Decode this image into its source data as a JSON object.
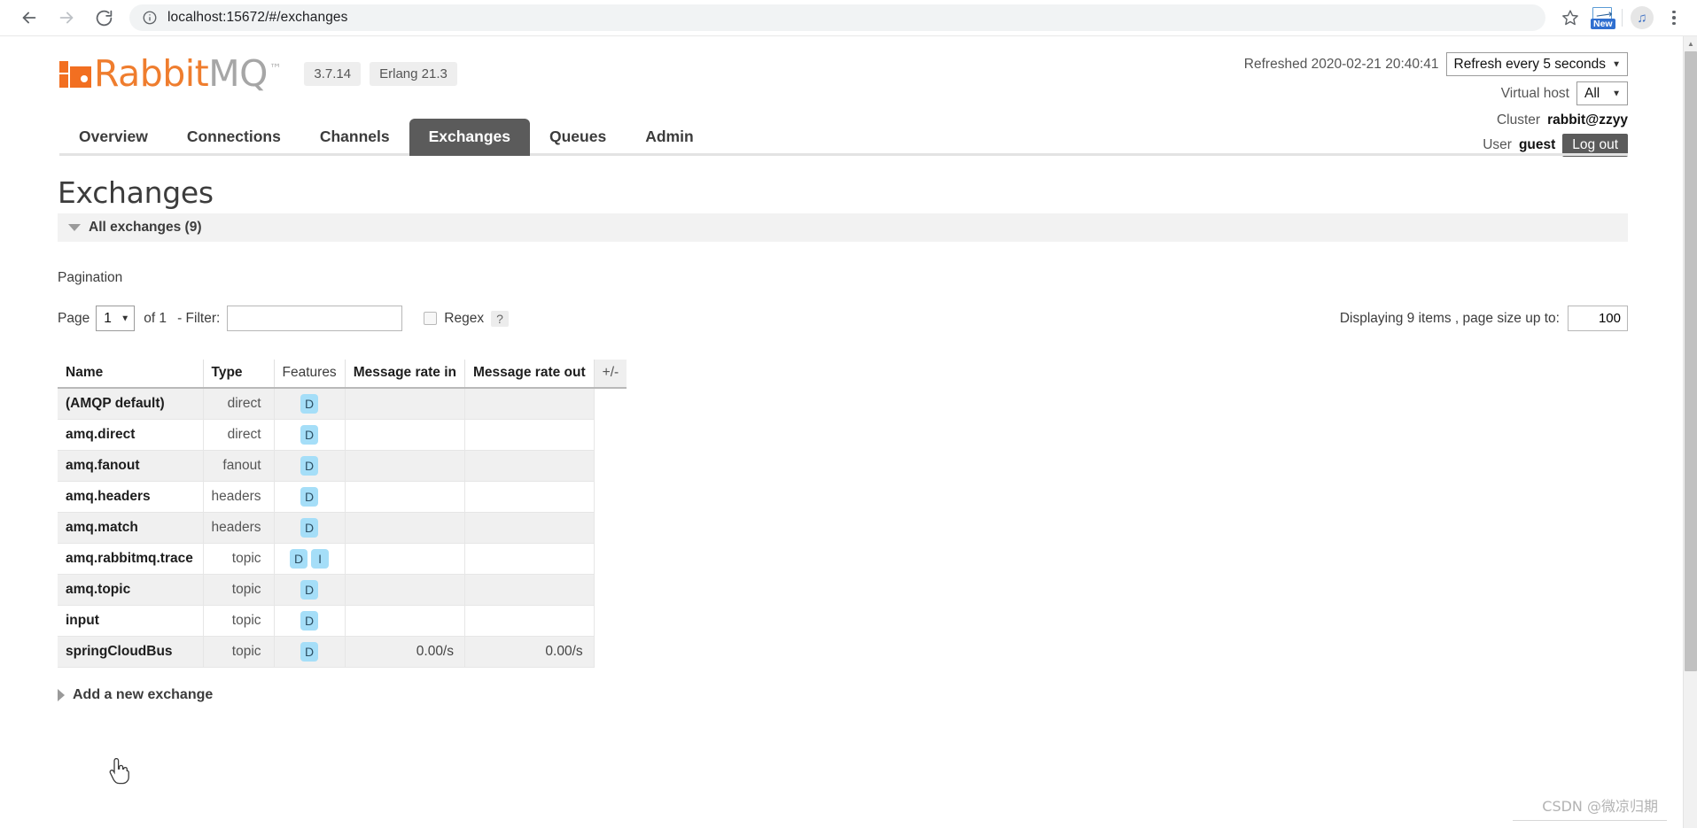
{
  "browser": {
    "back_icon": "arrow-left-icon",
    "forward_icon": "arrow-right-icon",
    "reload_icon": "reload-icon",
    "site_info_icon": "info-circle-icon",
    "url_scheme": "",
    "url": "localhost:15672/#/exchanges",
    "bookmark_icon": "star-icon",
    "extension_new_label": "New",
    "extension_music_icon": "music-note-icon",
    "menu_icon": "kebab-menu-icon"
  },
  "header": {
    "logo_primary": "Rabbit",
    "logo_secondary": "MQ",
    "logo_tm": "™",
    "version_badge": "3.7.14",
    "erlang_badge": "Erlang 21.3",
    "refreshed_text": "Refreshed 2020-02-21 20:40:41",
    "refresh_interval": "Refresh every 5 seconds",
    "virtual_host_label": "Virtual host",
    "virtual_host_value": "All",
    "cluster_label": "Cluster",
    "cluster_value": "rabbit@zzyy",
    "user_label": "User",
    "user_value": "guest",
    "logout_label": "Log out"
  },
  "nav": {
    "tabs": [
      {
        "label": "Overview",
        "active": false
      },
      {
        "label": "Connections",
        "active": false
      },
      {
        "label": "Channels",
        "active": false
      },
      {
        "label": "Exchanges",
        "active": true
      },
      {
        "label": "Queues",
        "active": false
      },
      {
        "label": "Admin",
        "active": false
      }
    ]
  },
  "main": {
    "page_title": "Exchanges",
    "section_label": "All exchanges (9)",
    "pagination_label": "Pagination",
    "page_label": "Page",
    "page_value": "1",
    "of_text": "of 1",
    "filter_label": "- Filter:",
    "filter_value": "",
    "filter_placeholder": "",
    "regex_label": "Regex",
    "help_label": "?",
    "displaying_text": "Displaying 9 items , page size up to:",
    "page_size_value": "100",
    "add_exchange_label": "Add a new exchange"
  },
  "table": {
    "columns": [
      "Name",
      "Type",
      "Features",
      "Message rate in",
      "Message rate out",
      "+/-"
    ],
    "rows": [
      {
        "name": "(AMQP default)",
        "type": "direct",
        "features": [
          "D"
        ],
        "rate_in": "",
        "rate_out": "",
        "link": false
      },
      {
        "name": "amq.direct",
        "type": "direct",
        "features": [
          "D"
        ],
        "rate_in": "",
        "rate_out": "",
        "link": false
      },
      {
        "name": "amq.fanout",
        "type": "fanout",
        "features": [
          "D"
        ],
        "rate_in": "",
        "rate_out": "",
        "link": false
      },
      {
        "name": "amq.headers",
        "type": "headers",
        "features": [
          "D"
        ],
        "rate_in": "",
        "rate_out": "",
        "link": false
      },
      {
        "name": "amq.match",
        "type": "headers",
        "features": [
          "D"
        ],
        "rate_in": "",
        "rate_out": "",
        "link": false
      },
      {
        "name": "amq.rabbitmq.trace",
        "type": "topic",
        "features": [
          "D",
          "I"
        ],
        "rate_in": "",
        "rate_out": "",
        "link": false
      },
      {
        "name": "amq.topic",
        "type": "topic",
        "features": [
          "D"
        ],
        "rate_in": "",
        "rate_out": "",
        "link": false
      },
      {
        "name": "input",
        "type": "topic",
        "features": [
          "D"
        ],
        "rate_in": "",
        "rate_out": "",
        "link": false
      },
      {
        "name": "springCloudBus",
        "type": "topic",
        "features": [
          "D"
        ],
        "rate_in": "0.00/s",
        "rate_out": "0.00/s",
        "link": true
      }
    ]
  },
  "watermark": "CSDN @微凉归期",
  "colors": {
    "brand_orange": "#ef7d2e",
    "tab_active_bg": "#5b5b5b",
    "feature_badge_bg": "#a5def8",
    "link_orange": "#e86f1e"
  }
}
